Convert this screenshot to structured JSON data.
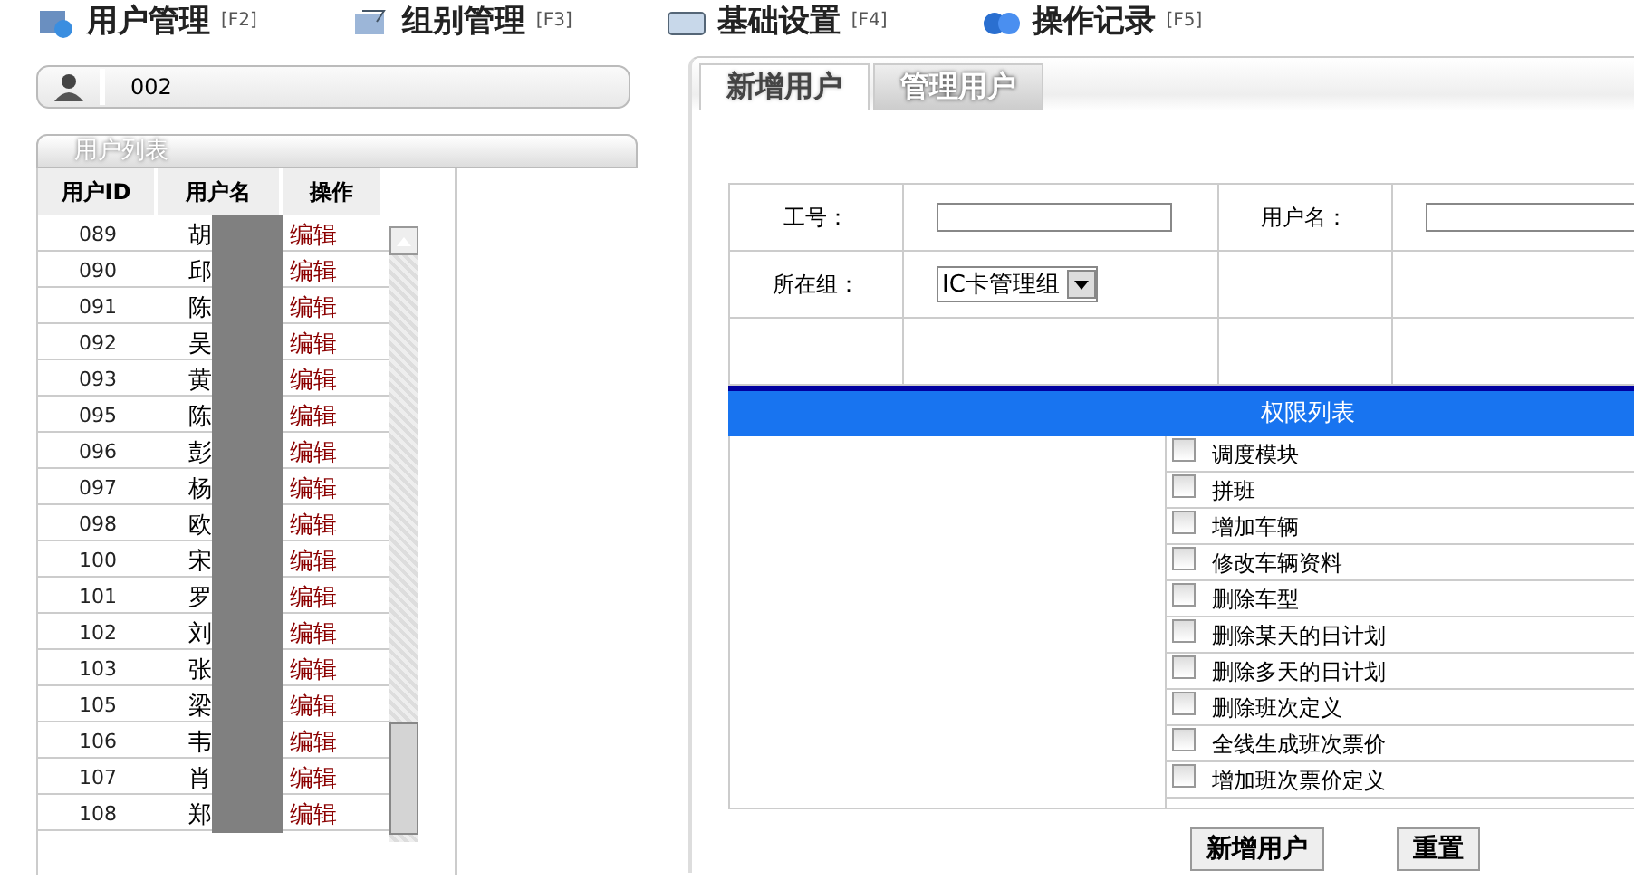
{
  "nav": [
    {
      "label": "用户管理",
      "shortcut": "[F2]",
      "kind": "users"
    },
    {
      "label": "组别管理",
      "shortcut": "[F3]",
      "kind": "group"
    },
    {
      "label": "基础设置",
      "shortcut": "[F4]",
      "kind": "settings"
    },
    {
      "label": "操作记录",
      "shortcut": "[F5]",
      "kind": "log"
    }
  ],
  "search": {
    "value": "002"
  },
  "user_list": {
    "title": "用户列表",
    "columns": [
      "用户ID",
      "用户名",
      "操作"
    ],
    "rows": [
      {
        "id": "089",
        "name": "胡",
        "action": "编辑"
      },
      {
        "id": "090",
        "name": "邱",
        "action": "编辑"
      },
      {
        "id": "091",
        "name": "陈",
        "action": "编辑"
      },
      {
        "id": "092",
        "name": "吴",
        "action": "编辑"
      },
      {
        "id": "093",
        "name": "黄",
        "action": "编辑"
      },
      {
        "id": "095",
        "name": "陈",
        "action": "编辑"
      },
      {
        "id": "096",
        "name": "彭",
        "action": "编辑"
      },
      {
        "id": "097",
        "name": "杨",
        "action": "编辑"
      },
      {
        "id": "098",
        "name": "欧",
        "action": "编辑"
      },
      {
        "id": "100",
        "name": "宋",
        "action": "编辑"
      },
      {
        "id": "101",
        "name": "罗",
        "action": "编辑"
      },
      {
        "id": "102",
        "name": "刘",
        "action": "编辑"
      },
      {
        "id": "103",
        "name": "张",
        "action": "编辑"
      },
      {
        "id": "105",
        "name": "梁",
        "action": "编辑"
      },
      {
        "id": "106",
        "name": "韦",
        "action": "编辑"
      },
      {
        "id": "107",
        "name": "肖",
        "action": "编辑"
      },
      {
        "id": "108",
        "name": "郑",
        "action": "编辑"
      }
    ]
  },
  "tabs": [
    {
      "label": "新增用户",
      "selected": true
    },
    {
      "label": "管理用户",
      "selected": false
    }
  ],
  "form": {
    "fields": [
      {
        "label": "工号：",
        "kind": "text"
      },
      {
        "label": "用户名：",
        "kind": "text"
      },
      {
        "label": "所在组：",
        "kind": "select",
        "value": "IC卡管理组"
      }
    ]
  },
  "permissions": {
    "title": "权限列表",
    "items": [
      {
        "label": "调度模块",
        "checked": false
      },
      {
        "label": "拼班",
        "checked": false
      },
      {
        "label": "增加车辆",
        "checked": false
      },
      {
        "label": "修改车辆资料",
        "checked": false
      },
      {
        "label": "删除车型",
        "checked": false
      },
      {
        "label": "删除某天的日计划",
        "checked": false
      },
      {
        "label": "删除多天的日计划",
        "checked": false
      },
      {
        "label": "删除班次定义",
        "checked": false
      },
      {
        "label": "全线生成班次票价",
        "checked": false
      },
      {
        "label": "增加班次票价定义",
        "checked": false
      }
    ]
  },
  "buttons": [
    "新增用户",
    "重置"
  ]
}
